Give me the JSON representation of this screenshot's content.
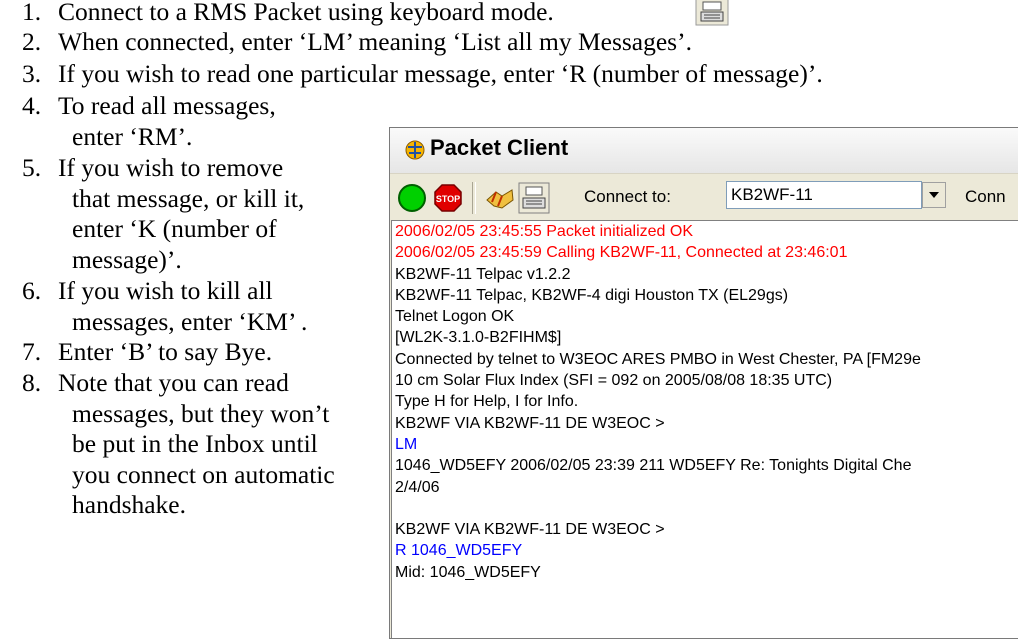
{
  "doc": {
    "steps": [
      {
        "num": "1.",
        "lines": [
          "Connect to a RMS Packet using keyboard mode."
        ]
      },
      {
        "num": "2.",
        "lines": [
          "When connected, enter ‘LM’ meaning ‘List all my Messages’."
        ]
      },
      {
        "num": "3.",
        "lines": [
          "If you wish to read one particular message, enter ‘R (number of message)’."
        ]
      },
      {
        "num": "4.",
        "lines": [
          "To read all messages,",
          "enter ‘RM’."
        ]
      },
      {
        "num": "5.",
        "lines": [
          "If you wish to remove",
          "that message, or kill it,",
          "enter ‘K (number of",
          "message)’."
        ]
      },
      {
        "num": "6.",
        "lines": [
          "If you wish to kill all",
          "messages, enter ‘KM’ ."
        ]
      },
      {
        "num": "7.",
        "lines": [
          "Enter ‘B’ to say Bye."
        ]
      },
      {
        "num": "8.",
        "lines": [
          "Note that you can read",
          "messages, but they won’t",
          "be put in the Inbox until",
          "you connect on automatic",
          "handshake."
        ]
      }
    ]
  },
  "window": {
    "title": "Packet Client",
    "connect_label": "Connect to:",
    "connect_value": "KB2WF-11",
    "connect_cut": "Conn",
    "icons": [
      "globe-title-icon",
      "green-go-icon",
      "stop-icon",
      "handshake-icon",
      "keyboard-icon"
    ]
  },
  "terminal": [
    {
      "text": "2006/02/05 23:45:55 Packet initialized OK",
      "color": "red"
    },
    {
      "text": "2006/02/05 23:45:59 Calling KB2WF-11, Connected at 23:46:01",
      "color": "red"
    },
    {
      "text": "KB2WF-11 Telpac v1.2.2",
      "color": "black"
    },
    {
      "text": "KB2WF-11 Telpac, KB2WF-4 digi Houston TX (EL29gs)",
      "color": "black"
    },
    {
      "text": "Telnet Logon OK",
      "color": "black"
    },
    {
      "text": "[WL2K-3.1.0-B2FIHM$]",
      "color": "black"
    },
    {
      "text": "Connected by telnet to W3EOC ARES PMBO in West Chester, PA [FM29e",
      "color": "black"
    },
    {
      "text": "10 cm Solar Flux Index (SFI = 092 on 2005/08/08 18:35 UTC)",
      "color": "black"
    },
    {
      "text": "Type H for Help, I for Info.",
      "color": "black"
    },
    {
      "text": "KB2WF VIA KB2WF-11 DE W3EOC >",
      "color": "black"
    },
    {
      "text": "LM",
      "color": "blue"
    },
    {
      "text": "1046_WD5EFY 2006/02/05 23:39 211 WD5EFY Re: Tonights Digital Che",
      "color": "black"
    },
    {
      "text": "2/4/06",
      "color": "black"
    },
    {
      "text": "",
      "color": "black"
    },
    {
      "text": "KB2WF VIA KB2WF-11 DE W3EOC >",
      "color": "black"
    },
    {
      "text": "R 1046_WD5EFY",
      "color": "blue"
    },
    {
      "text": "Mid:      1046_WD5EFY",
      "color": "black"
    }
  ]
}
